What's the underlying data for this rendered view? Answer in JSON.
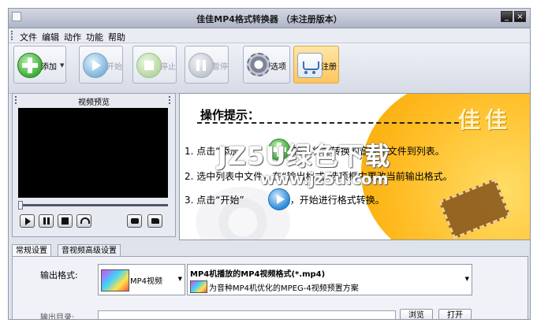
{
  "window": {
    "title": "佳佳MP4格式转换器 （未注册版本）",
    "min_glyph": "_",
    "close_glyph": "×"
  },
  "menu": [
    "文件",
    "编辑",
    "动作",
    "功能",
    "帮助"
  ],
  "toolbar": {
    "add_label": "添加",
    "start_label": "开始",
    "stop_label": "停止",
    "pause_label": "暂停",
    "options_label": "选项",
    "register_label": "注册",
    "dropdown_glyph": "▼"
  },
  "preview": {
    "title": "视频预览",
    "progress": 0
  },
  "tips": {
    "heading": "操作提示：",
    "brand": "佳佳",
    "step1_pre": "1. 点击“添加”",
    "step1_post": "按钮输入将要转换的音视频文件到列表。",
    "step2": "2. 选中列表中文件，在“输出格式”选项框中更改当前输出格式。",
    "step3_pre": "3. 点击“开始”",
    "step3_post": "按钮，开始进行格式转换。"
  },
  "watermark": {
    "line1": "JZ5U绿色下载",
    "line2": "www.jz5u.com"
  },
  "tabs": [
    "常规设置",
    "音视频高级设置"
  ],
  "settings": {
    "output_format_label": "输出格式:",
    "format_short": "MP4视频",
    "format_title": "MP4机播放的MP4视频格式(*.mp4)",
    "format_desc": "为音种MP4机优化的MPEG-4视频预置方案",
    "dropdown_glyph": "▼",
    "output_dir_label": "输出目录:",
    "output_dir_value": "",
    "browse_label": "浏览",
    "open_label": "打开"
  },
  "colors": {
    "tips_accent": "#ffbb22",
    "register_bg": "#ffc65a",
    "add_green": "#3fae36",
    "play_blue": "#2c8ad8"
  }
}
